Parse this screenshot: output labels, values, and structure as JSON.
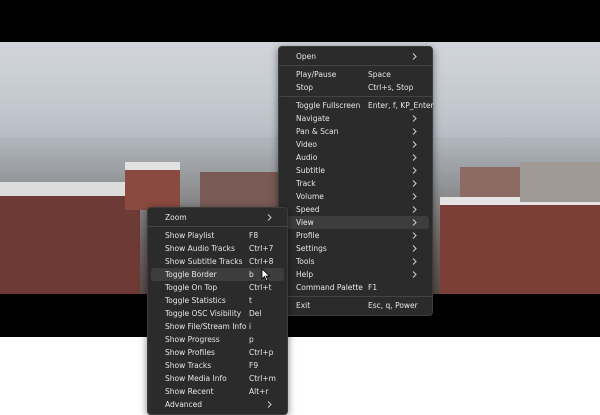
{
  "main_menu": {
    "items": [
      {
        "label": "Open",
        "shortcut": "",
        "submenu": true
      },
      {
        "separator": true
      },
      {
        "label": "Play/Pause",
        "shortcut": "Space",
        "submenu": false
      },
      {
        "label": "Stop",
        "shortcut": "Ctrl+s, Stop",
        "submenu": false
      },
      {
        "separator": true
      },
      {
        "label": "Toggle Fullscreen",
        "shortcut": "Enter, f, KP_Enter",
        "submenu": false
      },
      {
        "label": "Navigate",
        "shortcut": "",
        "submenu": true
      },
      {
        "label": "Pan & Scan",
        "shortcut": "",
        "submenu": true
      },
      {
        "label": "Video",
        "shortcut": "",
        "submenu": true
      },
      {
        "label": "Audio",
        "shortcut": "",
        "submenu": true
      },
      {
        "label": "Subtitle",
        "shortcut": "",
        "submenu": true
      },
      {
        "label": "Track",
        "shortcut": "",
        "submenu": true
      },
      {
        "label": "Volume",
        "shortcut": "",
        "submenu": true
      },
      {
        "label": "Speed",
        "shortcut": "",
        "submenu": true
      },
      {
        "label": "View",
        "shortcut": "",
        "submenu": true,
        "highlighted": true
      },
      {
        "label": "Profile",
        "shortcut": "",
        "submenu": true
      },
      {
        "label": "Settings",
        "shortcut": "",
        "submenu": true
      },
      {
        "label": "Tools",
        "shortcut": "",
        "submenu": true
      },
      {
        "label": "Help",
        "shortcut": "",
        "submenu": true
      },
      {
        "label": "Command Palette",
        "shortcut": "F1",
        "submenu": false
      },
      {
        "separator": true
      },
      {
        "label": "Exit",
        "shortcut": "Esc, q, Power",
        "submenu": false
      }
    ]
  },
  "view_menu": {
    "items": [
      {
        "label": "Zoom",
        "shortcut": "",
        "submenu": true
      },
      {
        "separator": true
      },
      {
        "label": "Show Playlist",
        "shortcut": "F8",
        "submenu": false
      },
      {
        "label": "Show Audio Tracks",
        "shortcut": "Ctrl+7",
        "submenu": false
      },
      {
        "label": "Show Subtitle Tracks",
        "shortcut": "Ctrl+8",
        "submenu": false
      },
      {
        "label": "Toggle Border",
        "shortcut": "b",
        "submenu": false,
        "highlighted": true
      },
      {
        "label": "Toggle On Top",
        "shortcut": "Ctrl+t",
        "submenu": false
      },
      {
        "label": "Toggle Statistics",
        "shortcut": "t",
        "submenu": false
      },
      {
        "label": "Toggle OSC Visibility",
        "shortcut": "Del",
        "submenu": false
      },
      {
        "label": "Show File/Stream Info",
        "shortcut": "i",
        "submenu": false
      },
      {
        "label": "Show Progress",
        "shortcut": "p",
        "submenu": false
      },
      {
        "label": "Show Profiles",
        "shortcut": "Ctrl+p",
        "submenu": false
      },
      {
        "label": "Show Tracks",
        "shortcut": "F9",
        "submenu": false
      },
      {
        "label": "Show Media Info",
        "shortcut": "Ctrl+m",
        "submenu": false
      },
      {
        "label": "Show Recent",
        "shortcut": "Alt+r",
        "submenu": false
      },
      {
        "label": "Advanced",
        "shortcut": "",
        "submenu": true
      }
    ]
  },
  "colors": {
    "menu_bg": "#2b2b2b",
    "menu_text": "#e6e6e6",
    "highlight": "#3d3d3d",
    "player_bg": "#000000"
  },
  "icons": {
    "submenu": "chevron-right-icon",
    "pointer": "mouse-cursor-icon"
  }
}
